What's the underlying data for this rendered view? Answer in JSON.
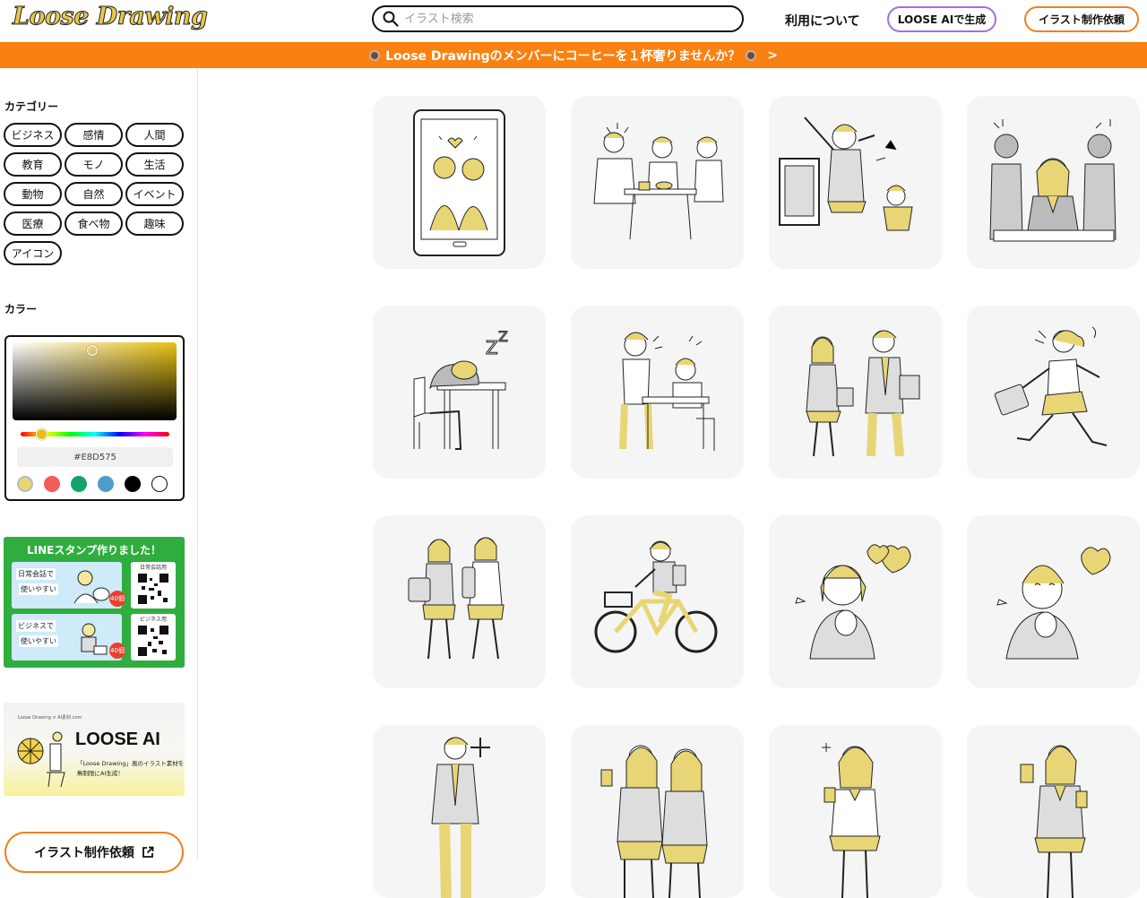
{
  "header": {
    "logo": "Loose Drawing",
    "search_placeholder": "イラスト検索",
    "nav_about": "利用について",
    "btn_ai": "LOOSE AIで生成",
    "btn_request": "イラスト制作依頼"
  },
  "banner": {
    "text": "Loose Drawingのメンバーにコーヒーを１杯奢りませんか？",
    "arrow": ">"
  },
  "sidebar": {
    "category_title": "カテゴリー",
    "categories": [
      "ビジネス",
      "感情",
      "人間",
      "教育",
      "モノ",
      "生活",
      "動物",
      "自然",
      "イベント",
      "医療",
      "食べ物",
      "趣味",
      "アイコン"
    ],
    "color_title": "カラー",
    "hex_value": "#E8D575",
    "swatches": [
      "#e8d575",
      "#f15b5b",
      "#12a36a",
      "#4e9dc8",
      "#000000",
      "#ffffff"
    ],
    "line_ad": {
      "title": "LINEスタンプ作りました！",
      "card1_t1": "日常会話で",
      "card1_t2": "使いやすい",
      "card1_badge": "40個",
      "qr1_caption": "日常会話用",
      "card2_t1": "ビジネスで",
      "card2_t2": "使いやすい",
      "card2_badge": "40個",
      "qr2_caption": "ビジネス用"
    },
    "ai_ad": {
      "small": "Loose Drawing × AI素材.com",
      "big": "LOOSE AI",
      "desc1": "「Loose Drawing」風のイラスト素材を",
      "desc2": "無制限にAI生成！"
    },
    "request_button": "イラスト制作依頼"
  },
  "illustrations": [
    "smartphone-couple",
    "group-meeting",
    "karaoke-singing",
    "person-between-coworkers",
    "sleeping-at-desk",
    "students-at-desk",
    "two-business-people-walking",
    "running-with-bag",
    "students-with-bags",
    "person-on-bicycle",
    "smiling-girl-with-heart",
    "smiling-boy-with-heart",
    "businessman-standing",
    "two-girls-with-drinks",
    "girl-thinking",
    "boy-with-drink"
  ]
}
